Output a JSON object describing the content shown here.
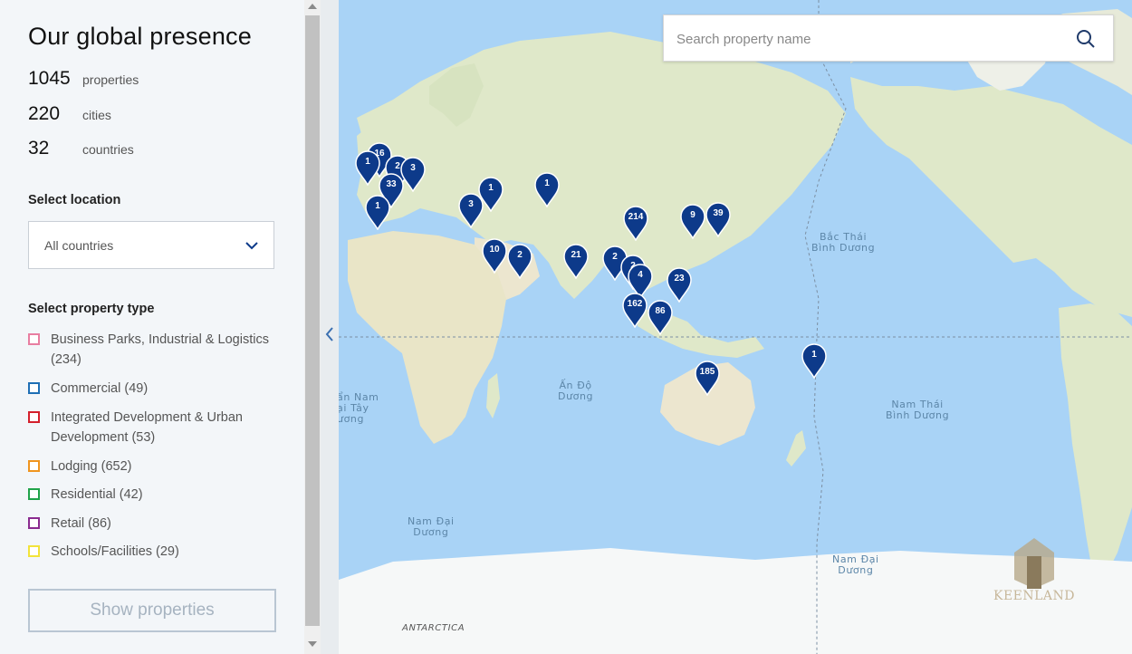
{
  "sidebar": {
    "title": "Our global presence",
    "stats": [
      {
        "value": "1045",
        "label": "properties"
      },
      {
        "value": "220",
        "label": "cities"
      },
      {
        "value": "32",
        "label": "countries"
      }
    ],
    "location_label": "Select location",
    "location_value": "All countries",
    "type_label": "Select property type",
    "property_types": [
      {
        "label": "Business Parks, Industrial & Logistics (234)",
        "color": "#e87ea1"
      },
      {
        "label": "Commercial (49)",
        "color": "#1f6fb5"
      },
      {
        "label": "Integrated Development & Urban Development (53)",
        "color": "#d4202c"
      },
      {
        "label": "Lodging (652)",
        "color": "#f0951f"
      },
      {
        "label": "Residential (42)",
        "color": "#20a34a"
      },
      {
        "label": "Retail (86)",
        "color": "#8a2b8f"
      },
      {
        "label": "Schools/Facilities (29)",
        "color": "#f2e33a"
      }
    ],
    "show_button": "Show properties"
  },
  "search": {
    "placeholder": "Search property name"
  },
  "map": {
    "ocean_labels": {
      "pacific_north": "Bắc Thái\nBình Dương",
      "pacific_south": "Nam Thái\nBình Dương",
      "indian": "Ấn Độ\nDương",
      "southern_left": "Nam Đại\nDương",
      "southern_right": "Nam Đại\nDương",
      "atlantic_south": "ẩn Nam\nại Tây\nương",
      "antarctica": "ANTARCTICA"
    },
    "pins": [
      "16",
      "1",
      "2",
      "3",
      "33",
      "1",
      "3",
      "1",
      "1",
      "10",
      "2",
      "21",
      "214",
      "2",
      "2",
      "4",
      "23",
      "162",
      "86",
      "9",
      "39",
      "185",
      "1"
    ],
    "zoom_in": "+",
    "zoom_out": "−",
    "watermark_text": "KEENLAND"
  },
  "colors": {
    "pin": "#0d3a8a",
    "ocean": "#a9d3f6",
    "land": "#dfe8c9"
  }
}
